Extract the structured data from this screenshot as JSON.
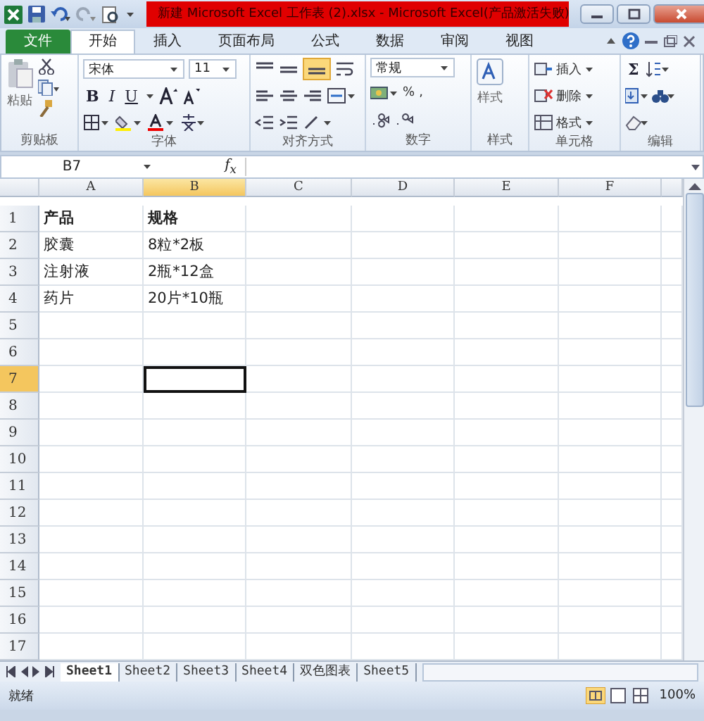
{
  "window": {
    "title": "新建 Microsoft Excel 工作表 (2).xlsx - Microsoft Excel(产品激活失败)"
  },
  "ribbon_tabs": [
    {
      "label": "文件",
      "kind": "file",
      "selected": false
    },
    {
      "label": "开始",
      "kind": "tab",
      "selected": true
    },
    {
      "label": "插入",
      "kind": "tab",
      "selected": false
    },
    {
      "label": "页面布局",
      "kind": "tab",
      "selected": false
    },
    {
      "label": "公式",
      "kind": "tab",
      "selected": false
    },
    {
      "label": "数据",
      "kind": "tab",
      "selected": false
    },
    {
      "label": "审阅",
      "kind": "tab",
      "selected": false
    },
    {
      "label": "视图",
      "kind": "tab",
      "selected": false
    }
  ],
  "ribbon": {
    "clipboard": {
      "label": "剪贴板",
      "paste": "粘贴"
    },
    "font": {
      "label": "字体",
      "font_name": "宋体",
      "font_size": "11",
      "bold": "B",
      "italic": "I",
      "underline": "U"
    },
    "alignment": {
      "label": "对齐方式",
      "bottom_align_on": true
    },
    "number": {
      "label": "数字",
      "format": "常规",
      "percent": "%",
      "comma": ","
    },
    "styles": {
      "label": "样式",
      "button": "样式"
    },
    "cells": {
      "label": "单元格",
      "insert": "插入",
      "delete": "删除",
      "format": "格式"
    },
    "editing": {
      "label": "编辑",
      "sum": "Σ"
    }
  },
  "formula_bar": {
    "name_box": "B7",
    "fx": "f$_{x}$"
  },
  "sheet": {
    "columns": [
      {
        "label": "A",
        "selected": false
      },
      {
        "label": "B",
        "selected": true
      },
      {
        "label": "C",
        "selected": false
      },
      {
        "label": "D",
        "selected": false
      },
      {
        "label": "E",
        "selected": false
      },
      {
        "label": "F",
        "selected": false
      }
    ],
    "rows": [
      {
        "label": "1",
        "selected": false,
        "cells": [
          {
            "text": "产品",
            "bold": true
          },
          {
            "text": "规格",
            "bold": true
          }
        ]
      },
      {
        "label": "2",
        "selected": false,
        "cells": [
          {
            "text": "胶囊",
            "bold": false
          },
          {
            "text": "8粒*2板",
            "bold": false
          }
        ]
      },
      {
        "label": "3",
        "selected": false,
        "cells": [
          {
            "text": "注射液",
            "bold": false
          },
          {
            "text": "2瓶*12盒",
            "bold": false
          }
        ]
      },
      {
        "label": "4",
        "selected": false,
        "cells": [
          {
            "text": "药片",
            "bold": false
          },
          {
            "text": "20片*10瓶",
            "bold": false
          }
        ]
      },
      {
        "label": "5",
        "selected": false
      },
      {
        "label": "6",
        "selected": false
      },
      {
        "label": "7",
        "selected": true
      },
      {
        "label": "8",
        "selected": false
      },
      {
        "label": "9",
        "selected": false
      },
      {
        "label": "10",
        "selected": false
      },
      {
        "label": "11",
        "selected": false
      },
      {
        "label": "12",
        "selected": false
      },
      {
        "label": "13",
        "selected": false
      },
      {
        "label": "14",
        "selected": false
      },
      {
        "label": "15",
        "selected": false
      },
      {
        "label": "16",
        "selected": false
      },
      {
        "label": "17",
        "selected": false
      }
    ]
  },
  "sheet_tabs": [
    {
      "label": "Sheet1",
      "selected": true
    },
    {
      "label": "Sheet2",
      "selected": false
    },
    {
      "label": "Sheet3",
      "selected": false
    },
    {
      "label": "Sheet4",
      "selected": false
    },
    {
      "label": "双色图表",
      "selected": false
    },
    {
      "label": "Sheet5",
      "selected": false
    }
  ],
  "status_bar": {
    "status": "就绪",
    "zoom": "100%"
  }
}
